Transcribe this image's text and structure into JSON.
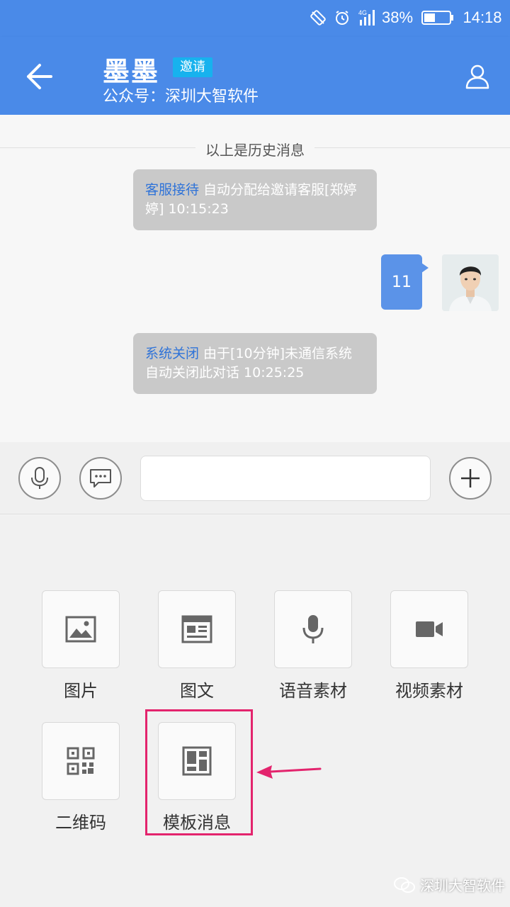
{
  "status": {
    "battery": "38%",
    "time": "14:18",
    "network": "4G"
  },
  "header": {
    "title": "墨墨",
    "badge": "邀请",
    "subtitle": "公众号：深圳大智软件",
    "color": "#4a8ae8"
  },
  "chat": {
    "history_label": "以上是历史消息",
    "messages": [
      {
        "keyword": "客服接待",
        "text": " 自动分配给邀请客服[郑婷婷] 10:15:23"
      },
      {
        "outgoing": "11"
      },
      {
        "keyword": "系统关闭",
        "text": " 由于[10分钟]未通信系统自动关闭此对话 10:25:25"
      }
    ]
  },
  "input": {
    "value": ""
  },
  "tools": [
    {
      "label": "图片",
      "icon": "image-icon"
    },
    {
      "label": "图文",
      "icon": "news-icon"
    },
    {
      "label": "语音素材",
      "icon": "microphone-icon"
    },
    {
      "label": "视频素材",
      "icon": "video-camera-icon"
    },
    {
      "label": "二维码",
      "icon": "qr-code-icon"
    },
    {
      "label": "模板消息",
      "icon": "template-icon"
    }
  ],
  "watermark": "深圳大智软件",
  "highlight_color": "#e3246d"
}
